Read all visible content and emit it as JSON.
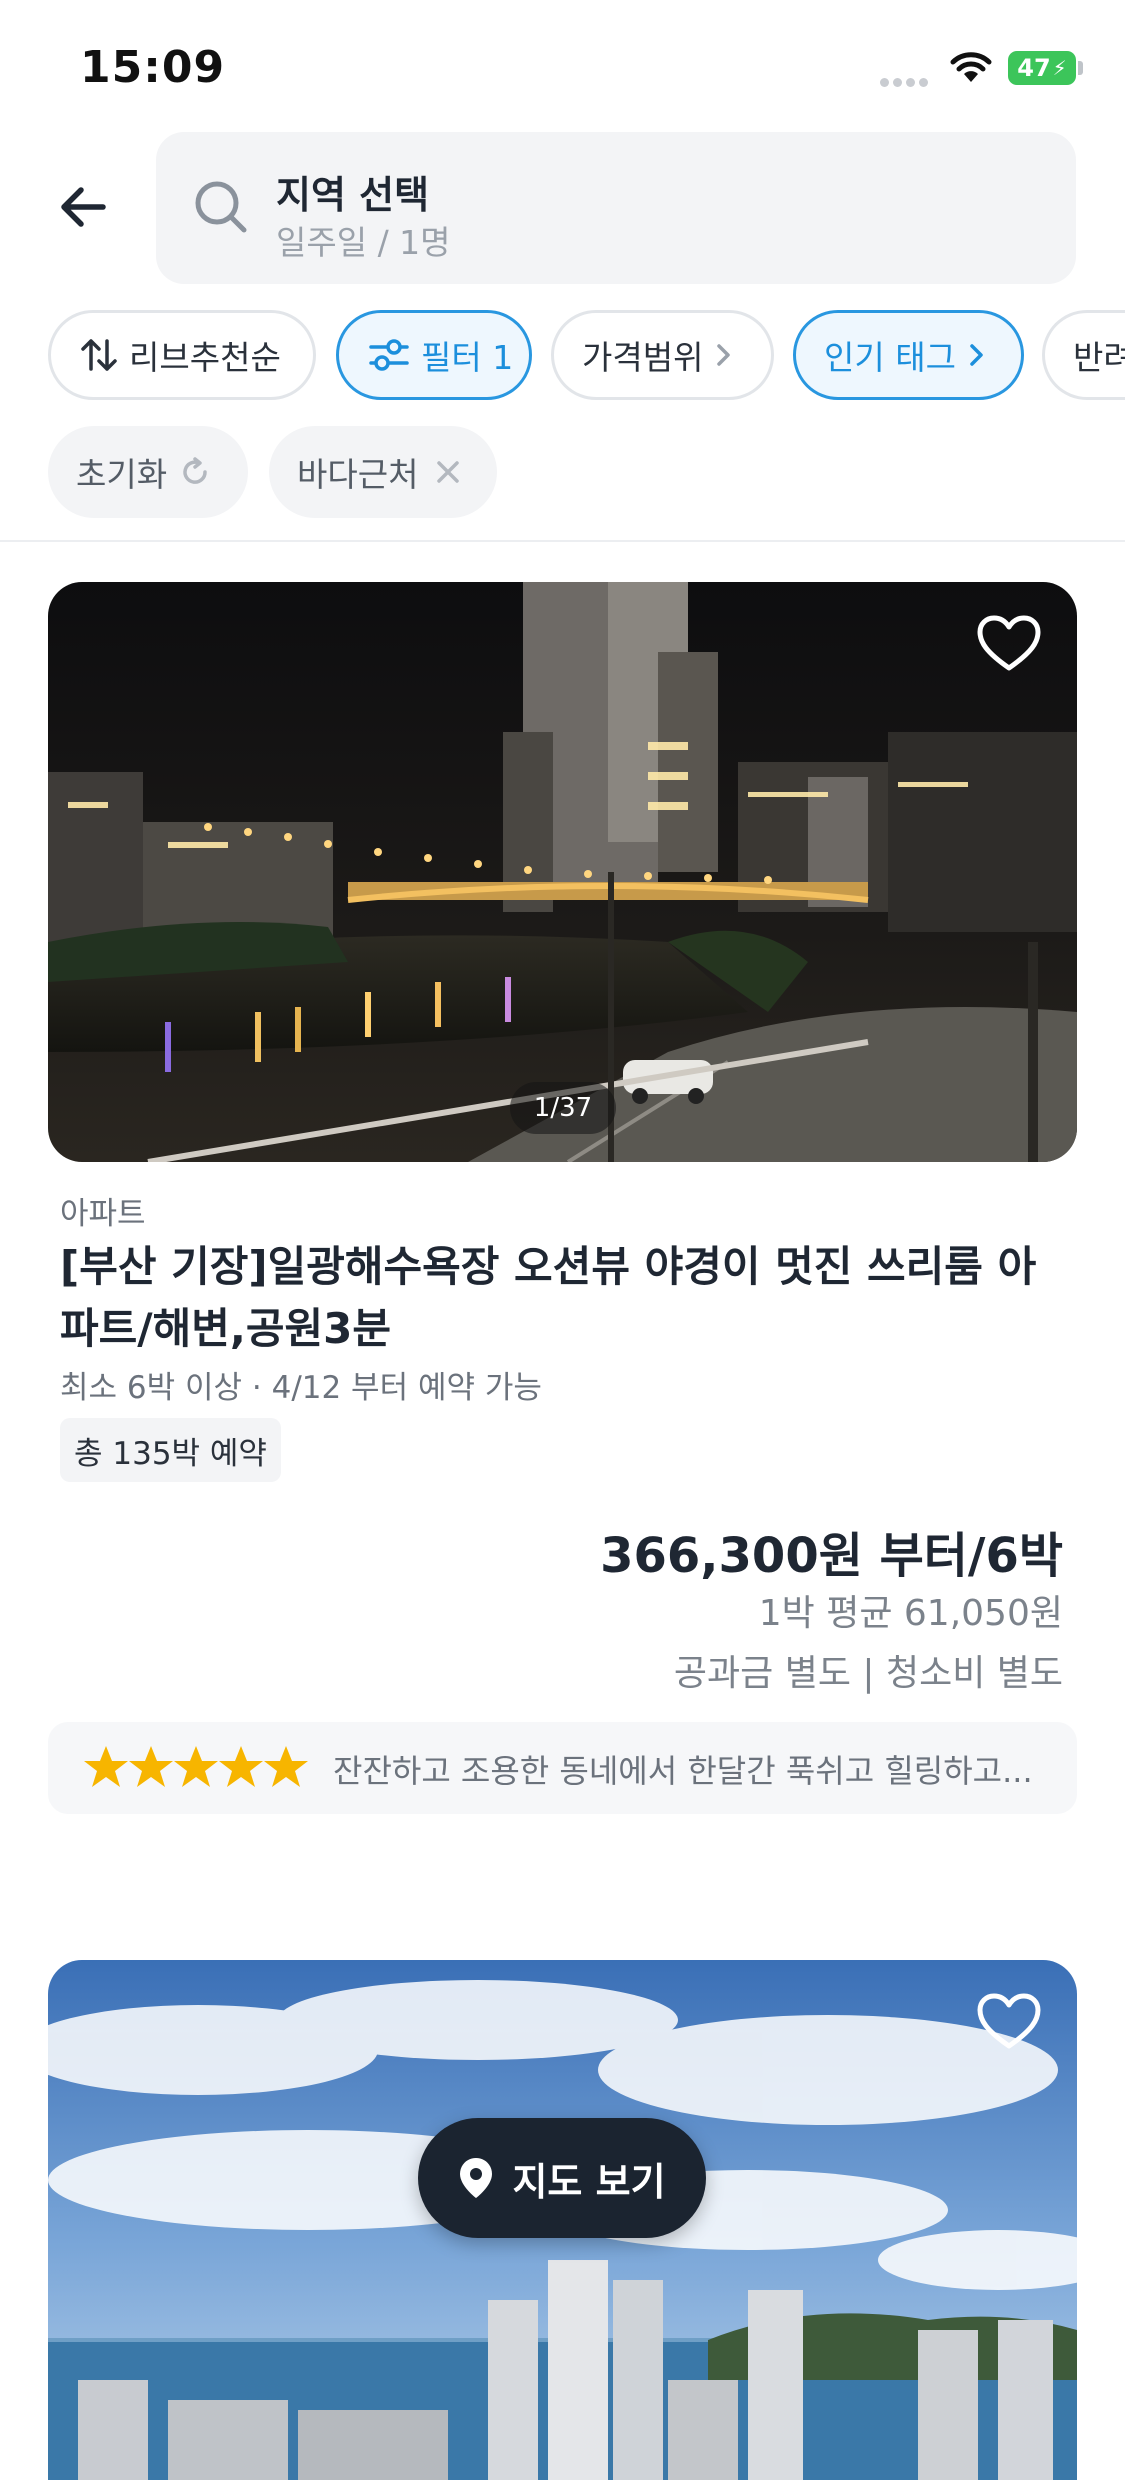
{
  "status_bar": {
    "time": "15:09",
    "battery": "47"
  },
  "search": {
    "title": "지역 선택",
    "subtitle": "일주일 / 1명"
  },
  "chips": {
    "sort": "리브추천순",
    "filter": "필터 1",
    "price_range": "가격범위",
    "popular_tags": "인기 태그",
    "partial": "반려"
  },
  "active_filters": {
    "reset": "초기화",
    "tag": "바다근처"
  },
  "listings": [
    {
      "photo_counter": "1/37",
      "type": "아파트",
      "title": "[부산 기장]일광해수욕장 오션뷰 야경이 멋진 쓰리룸 아파트/해변,공원3분",
      "meta": "최소 6박 이상 · 4/12 부터 예약 가능",
      "badge": "총 135박 예약",
      "price": "366,300원 부터/6박",
      "avg_price": "1박 평균 61,050원",
      "fees": "공과금 별도 | 청소비 별도",
      "rating": 5,
      "review": "잔잔하고 조용한 동네에서 한달간 푹쉬고 힐링하고..."
    }
  ],
  "map_button": {
    "label": "지도 보기"
  },
  "colors": {
    "accent": "#1c8fdc",
    "star": "#f7b500",
    "map_button_bg": "#1b2430"
  },
  "icons": [
    "back-arrow-icon",
    "search-icon",
    "sort-icon",
    "filter-sliders-icon",
    "chevron-right-icon",
    "refresh-icon",
    "close-icon",
    "heart-icon",
    "star-icon",
    "map-pin-icon"
  ]
}
